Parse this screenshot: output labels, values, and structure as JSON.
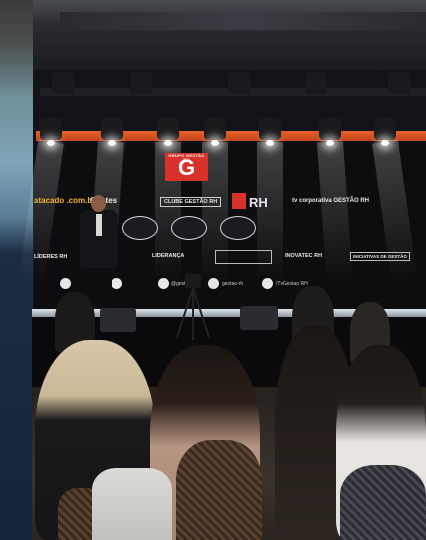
{
  "photo": {
    "subject": "conference stage with speaker",
    "screen_logos": {
      "main_logo_letter": "G",
      "main_logo_caption": "GRUPO GESTÃO RH",
      "row1": [
        "atacado .com.br",
        "Gentes",
        "CLUBE GESTÃO RH",
        "RH",
        "tv corporativa GESTÃO RH"
      ],
      "row2": [
        "LÍDERES RH",
        "LIDERANÇA",
        "INOVATEC RH",
        "INICIATIVAS DE GESTÃO"
      ],
      "social_handles": [
        "@gestao",
        "gestao",
        "gestao-rh",
        "/TvGestao RH"
      ]
    }
  }
}
